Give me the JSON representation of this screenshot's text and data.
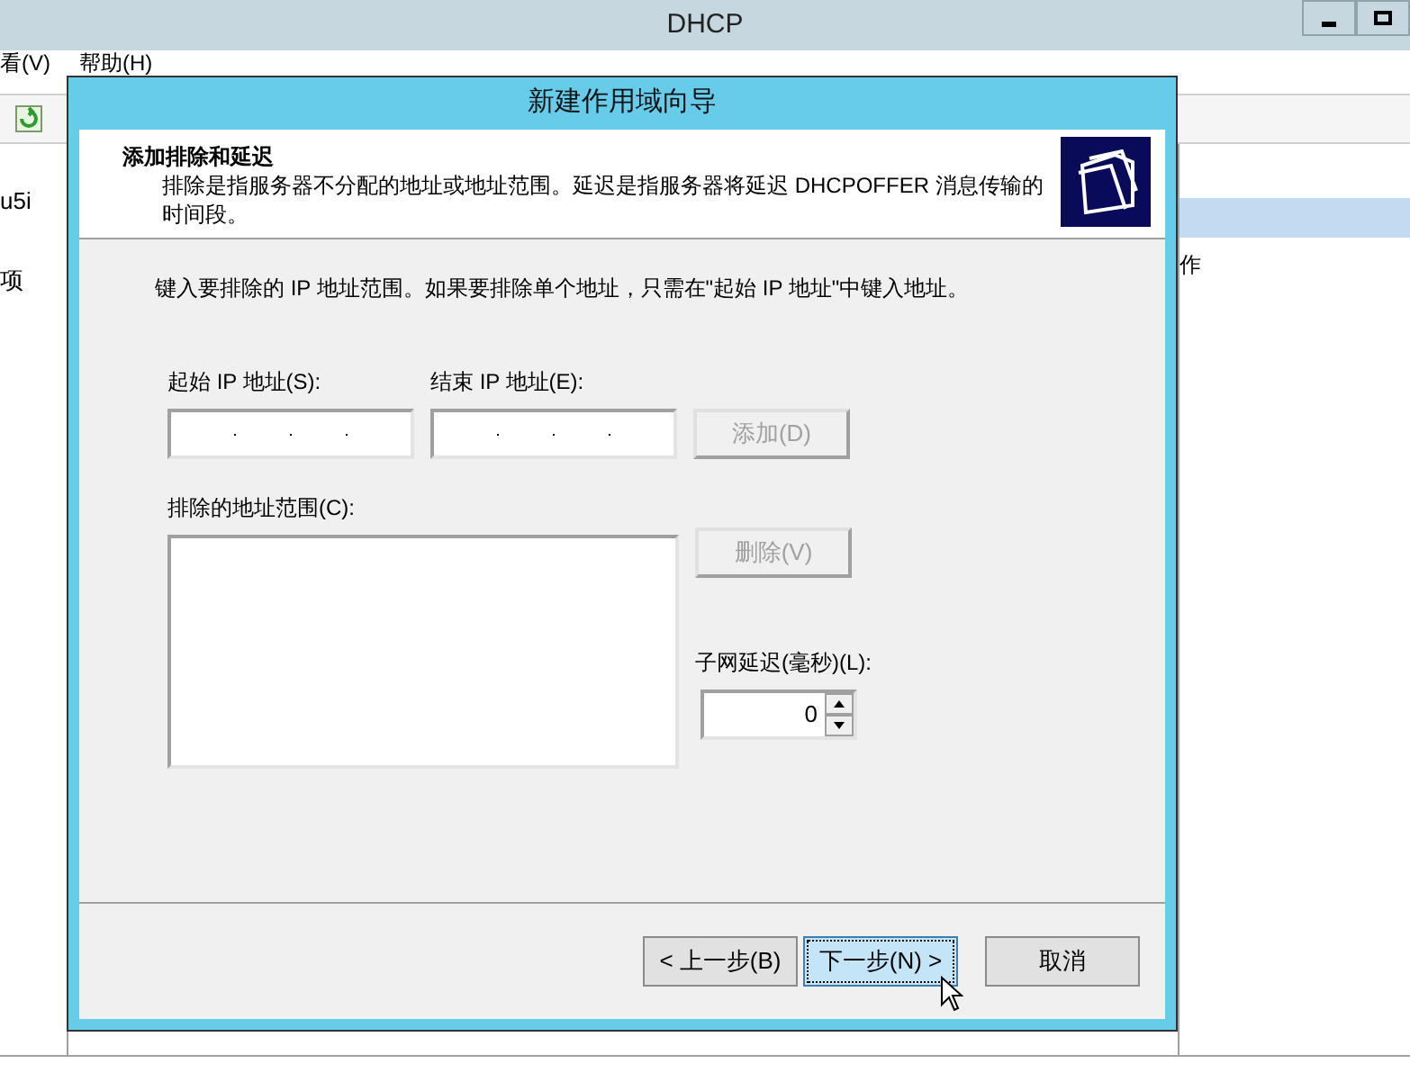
{
  "window": {
    "title": "DHCP"
  },
  "menu": [
    {
      "label": "看(V)"
    },
    {
      "label": "帮助(H)"
    }
  ],
  "left_pane": [
    {
      "label": "u5i"
    },
    {
      "label": "项"
    }
  ],
  "right_pane": [
    {
      "label": "作"
    }
  ],
  "dialog": {
    "title": "新建作用域向导",
    "header_title": "添加排除和延迟",
    "header_description": "排除是指服务器不分配的地址或地址范围。延迟是指服务器将延迟 DHCPOFFER 消息传输的时间段。",
    "instruction": "键入要排除的 IP 地址范围。如果要排除单个地址，只需在\"起始 IP 地址\"中键入地址。",
    "start_label": "起始 IP 地址(S):",
    "end_label": "结束 IP 地址(E):",
    "add_button": {
      "label": "添加(D)",
      "disabled": true
    },
    "list_label": "排除的地址范围(C):",
    "delete_button": {
      "label": "删除(V)",
      "disabled": true
    },
    "delay_label": "子网延迟(毫秒)(L):",
    "delay_value": "0",
    "buttons": [
      {
        "label": "< 上一步(B)",
        "focused": false
      },
      {
        "label": "下一步(N) >",
        "focused": true
      },
      {
        "label": "取消",
        "focused": false
      }
    ]
  }
}
